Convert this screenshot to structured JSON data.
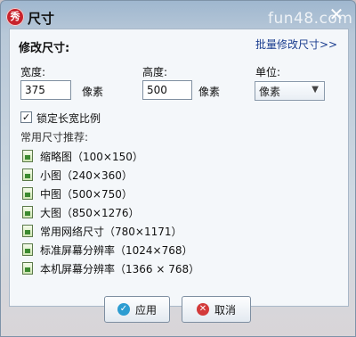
{
  "window": {
    "title": "尺寸",
    "watermark": "fun48.com",
    "app_icon": "秀",
    "close_icon": "✕"
  },
  "section": {
    "title": "修改尺寸:",
    "batch_link": "批量修改尺寸>>"
  },
  "width": {
    "label": "宽度:",
    "value": "375",
    "unit": "像素"
  },
  "height": {
    "label": "高度:",
    "value": "500",
    "unit": "像素"
  },
  "unit": {
    "label": "单位:",
    "selected": "像素"
  },
  "lock_ratio": {
    "label": "锁定长宽比例",
    "checked": true,
    "mark": "✓"
  },
  "presets": {
    "label": "常用尺寸推荐:",
    "items": [
      {
        "label": "缩略图（100×150）"
      },
      {
        "label": "小图（240×360）"
      },
      {
        "label": "中图（500×750）"
      },
      {
        "label": "大图（850×1276）"
      },
      {
        "label": "常用网络尺寸（780×1171）"
      },
      {
        "label": "标准屏幕分辨率（1024×768）"
      },
      {
        "label": "本机屏幕分辨率（1366 × 768）"
      }
    ]
  },
  "buttons": {
    "ok": "应用",
    "cancel": "取消"
  },
  "colors": {
    "link": "#1a3d8f",
    "ok_icon": "#2c9cd1",
    "cancel_icon": "#d33a3a",
    "app_icon": "#c8232c"
  }
}
